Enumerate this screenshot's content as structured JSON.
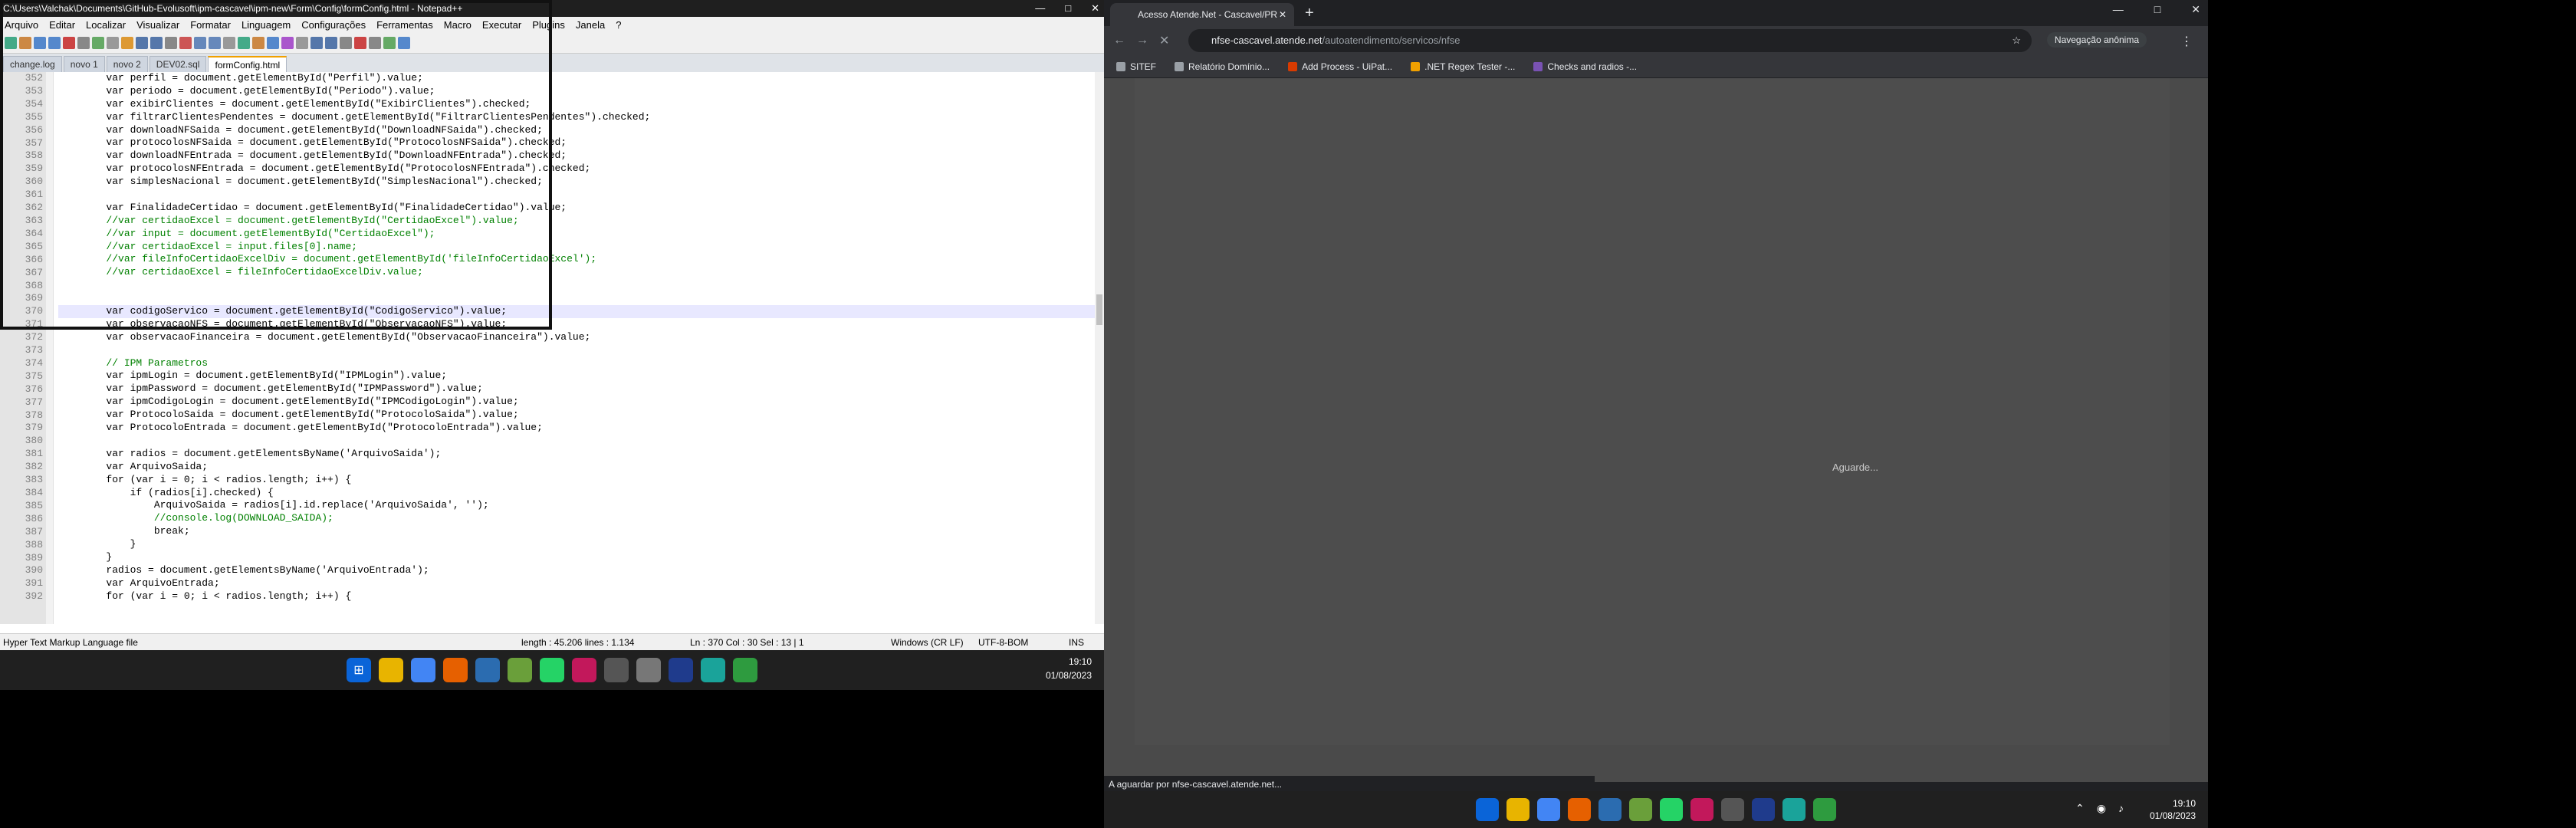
{
  "npp": {
    "title": "C:\\Users\\Valchak\\Documents\\GitHub-Evolusoft\\ipm-cascavel\\ipm-new\\Form\\Config\\formConfig.html - Notepad++",
    "menu": [
      "Arquivo",
      "Editar",
      "Localizar",
      "Visualizar",
      "Formatar",
      "Linguagem",
      "Configurações",
      "Ferramentas",
      "Macro",
      "Executar",
      "Plugins",
      "Janela",
      "?"
    ],
    "tabs": [
      "change.log",
      "novo 1",
      "novo 2",
      "DEV02.sql",
      "formConfig.html"
    ],
    "lines": [
      {
        "n": "352",
        "t": "        var perfil = document.getElementById(\"Perfil\").value;"
      },
      {
        "n": "353",
        "t": "        var periodo = document.getElementById(\"Periodo\").value;"
      },
      {
        "n": "354",
        "t": "        var exibirClientes = document.getElementById(\"ExibirClientes\").checked;"
      },
      {
        "n": "355",
        "t": "        var filtrarClientesPendentes = document.getElementById(\"FiltrarClientesPendentes\").checked;"
      },
      {
        "n": "356",
        "t": "        var downloadNFSaida = document.getElementById(\"DownloadNFSaida\").checked;"
      },
      {
        "n": "357",
        "t": "        var protocolosNFSaida = document.getElementById(\"ProtocolosNFSaida\").checked;"
      },
      {
        "n": "358",
        "t": "        var downloadNFEntrada = document.getElementById(\"DownloadNFEntrada\").checked;"
      },
      {
        "n": "359",
        "t": "        var protocolosNFEntrada = document.getElementById(\"ProtocolosNFEntrada\").checked;"
      },
      {
        "n": "360",
        "t": "        var simplesNacional = document.getElementById(\"SimplesNacional\").checked;"
      },
      {
        "n": "361",
        "t": ""
      },
      {
        "n": "362",
        "t": "        var FinalidadeCertidao = document.getElementById(\"FinalidadeCertidao\").value;"
      },
      {
        "n": "363",
        "t": "        //var certidaoExcel = document.getElementById(\"CertidaoExcel\").value;"
      },
      {
        "n": "364",
        "t": "        //var input = document.getElementById(\"CertidaoExcel\");"
      },
      {
        "n": "365",
        "t": "        //var certidaoExcel = input.files[0].name;"
      },
      {
        "n": "366",
        "t": "        //var fileInfoCertidaoExcelDiv = document.getElementById('fileInfoCertidaoExcel');"
      },
      {
        "n": "367",
        "t": "        //var certidaoExcel = fileInfoCertidaoExcelDiv.value;"
      },
      {
        "n": "368",
        "t": ""
      },
      {
        "n": "369",
        "t": ""
      },
      {
        "n": "370",
        "t": "        var codigoServico = document.getElementById(\"CodigoServico\").value;"
      },
      {
        "n": "371",
        "t": "        var observacaoNFS = document.getElementById(\"ObservacaoNFS\").value;"
      },
      {
        "n": "372",
        "t": "        var observacaoFinanceira = document.getElementById(\"ObservacaoFinanceira\").value;"
      },
      {
        "n": "373",
        "t": ""
      },
      {
        "n": "374",
        "t": "        // IPM Parametros"
      },
      {
        "n": "375",
        "t": "        var ipmLogin = document.getElementById(\"IPMLogin\").value;"
      },
      {
        "n": "376",
        "t": "        var ipmPassword = document.getElementById(\"IPMPassword\").value;"
      },
      {
        "n": "377",
        "t": "        var ipmCodigoLogin = document.getElementById(\"IPMCodigoLogin\").value;"
      },
      {
        "n": "378",
        "t": "        var ProtocoloSaida = document.getElementById(\"ProtocoloSaida\").value;"
      },
      {
        "n": "379",
        "t": "        var ProtocoloEntrada = document.getElementById(\"ProtocoloEntrada\").value;"
      },
      {
        "n": "380",
        "t": ""
      },
      {
        "n": "381",
        "t": "        var radios = document.getElementsByName('ArquivoSaida');"
      },
      {
        "n": "382",
        "t": "        var ArquivoSaida;"
      },
      {
        "n": "383",
        "t": "        for (var i = 0; i < radios.length; i++) {"
      },
      {
        "n": "384",
        "t": "            if (radios[i].checked) {"
      },
      {
        "n": "385",
        "t": "                ArquivoSaida = radios[i].id.replace('ArquivoSaida', '');"
      },
      {
        "n": "386",
        "t": "                //console.log(DOWNLOAD_SAIDA);"
      },
      {
        "n": "387",
        "t": "                break;"
      },
      {
        "n": "388",
        "t": "            }"
      },
      {
        "n": "389",
        "t": "        }"
      },
      {
        "n": "390",
        "t": "        radios = document.getElementsByName('ArquivoEntrada');"
      },
      {
        "n": "391",
        "t": "        var ArquivoEntrada;"
      },
      {
        "n": "392",
        "t": "        for (var i = 0; i < radios.length; i++) {"
      }
    ],
    "status": {
      "lang": "Hyper Text Markup Language file",
      "length": "length : 45.206    lines : 1.134",
      "pos": "Ln : 370    Col : 30    Sel : 13 | 1",
      "eol": "Windows (CR LF)",
      "enc": "UTF-8-BOM",
      "mode": "INS"
    }
  },
  "taskbar1": {
    "time": "19:10",
    "date": "01/08/2023"
  },
  "chrome": {
    "tab_title": "Acesso Atende.Net - Cascavel/PR",
    "url_host": "nfse-cascavel.atende.net",
    "url_path": "/autoatendimento/servicos/nfse",
    "incognito": "Navegação anônima",
    "bookmarks": [
      "SITEF",
      "Relatório Domínio...",
      "Add Process - UiPat...",
      ".NET Regex Tester -...",
      "Checks and radios -..."
    ],
    "wait_text": "Aguarde...",
    "status_text": "A aguardar por nfse-cascavel.atende.net...",
    "time": "19:10",
    "date": "01/08/2023"
  },
  "colors": {
    "accent": "#f0a000",
    "taskbar": "#202020",
    "chrome_bg": "#35363a"
  }
}
